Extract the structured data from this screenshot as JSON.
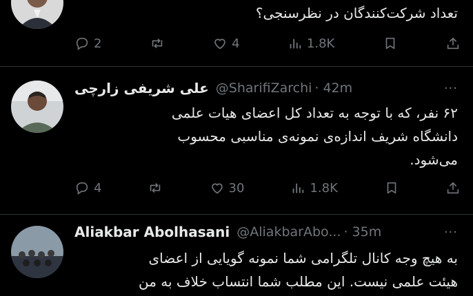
{
  "posts": [
    {
      "author_name": "",
      "handle": "",
      "time": "",
      "text_lines": [
        "تعداد شرکت‌کنندگان در نظرسنجی؟"
      ],
      "actions": {
        "replies": "2",
        "retweets": "",
        "likes": "4",
        "views": "1.8K"
      }
    },
    {
      "author_name": "علی شریفی زارچی",
      "handle": "@SharifiZarchi",
      "time": "· 42m",
      "more": "···",
      "text_lines": [
        "۶۲ نفر، که با توجه به تعداد کل اعضای هیات علمی",
        "دانشگاه شریف اندازه‌ی نمونه‌ی مناسبی محسوب",
        "می‌شود."
      ],
      "actions": {
        "replies": "4",
        "retweets": "",
        "likes": "30",
        "views": "1.8K"
      }
    },
    {
      "author_name": "Aliakbar Abolhasani",
      "handle": "@AliakbarAbo...",
      "time": "· 35m",
      "more": "···",
      "text_lines": [
        "به هیچ وجه کانال تلگرامی شما نمونه گویایی از اعضای",
        "هیئت علمی نیست. این مطلب شما انتساب خلاف به من"
      ]
    }
  ],
  "icons": {
    "reply": "reply-icon",
    "retweet": "retweet-icon",
    "like": "heart-icon",
    "views": "views-icon",
    "bookmark": "bookmark-icon",
    "share": "share-icon"
  },
  "colors": {
    "background": "#000000",
    "text": "#e7e9ea",
    "muted": "#71767b",
    "divider": "#2f3336"
  }
}
